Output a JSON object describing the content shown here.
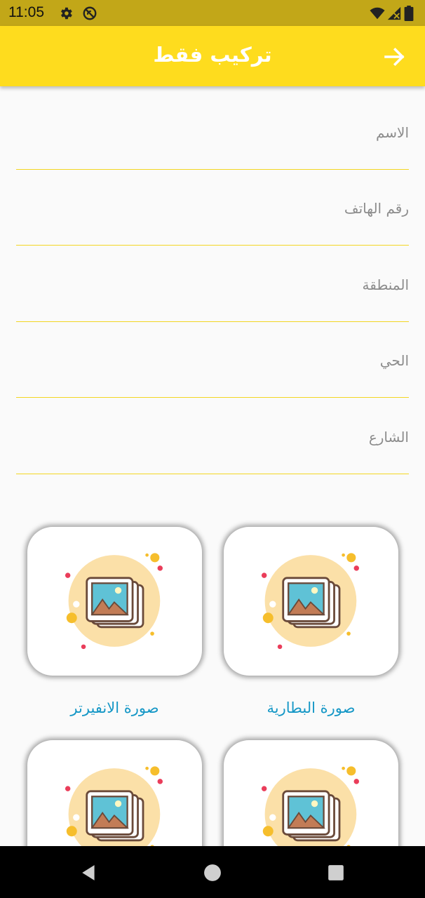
{
  "status_bar": {
    "time": "11:05",
    "left_icons": [
      "settings-icon",
      "do-not-disturb-icon"
    ],
    "right_icons": [
      "wifi-icon",
      "signal-icon",
      "battery-icon"
    ]
  },
  "app_bar": {
    "title": "تركيب فقط",
    "back_icon": "arrow-forward-icon",
    "color": "#fedc1e"
  },
  "form": {
    "fields": [
      {
        "placeholder": "الاسم",
        "value": ""
      },
      {
        "placeholder": "رقم الهاتف",
        "value": ""
      },
      {
        "placeholder": "المنطقة",
        "value": ""
      },
      {
        "placeholder": "الحي",
        "value": ""
      },
      {
        "placeholder": "الشارع",
        "value": ""
      }
    ],
    "underline_color": "#f3d622"
  },
  "images": {
    "cards": [
      {
        "label": "صورة البطارية",
        "icon": "image-gallery-icon"
      },
      {
        "label": "صورة الانفيرتر",
        "icon": "image-gallery-icon"
      },
      {
        "label": "",
        "icon": "image-gallery-icon"
      },
      {
        "label": "",
        "icon": "image-gallery-icon"
      }
    ],
    "label_color": "#1597c6"
  },
  "nav_bar": {
    "buttons": [
      "back-triangle-icon",
      "home-circle-icon",
      "recents-square-icon"
    ]
  }
}
